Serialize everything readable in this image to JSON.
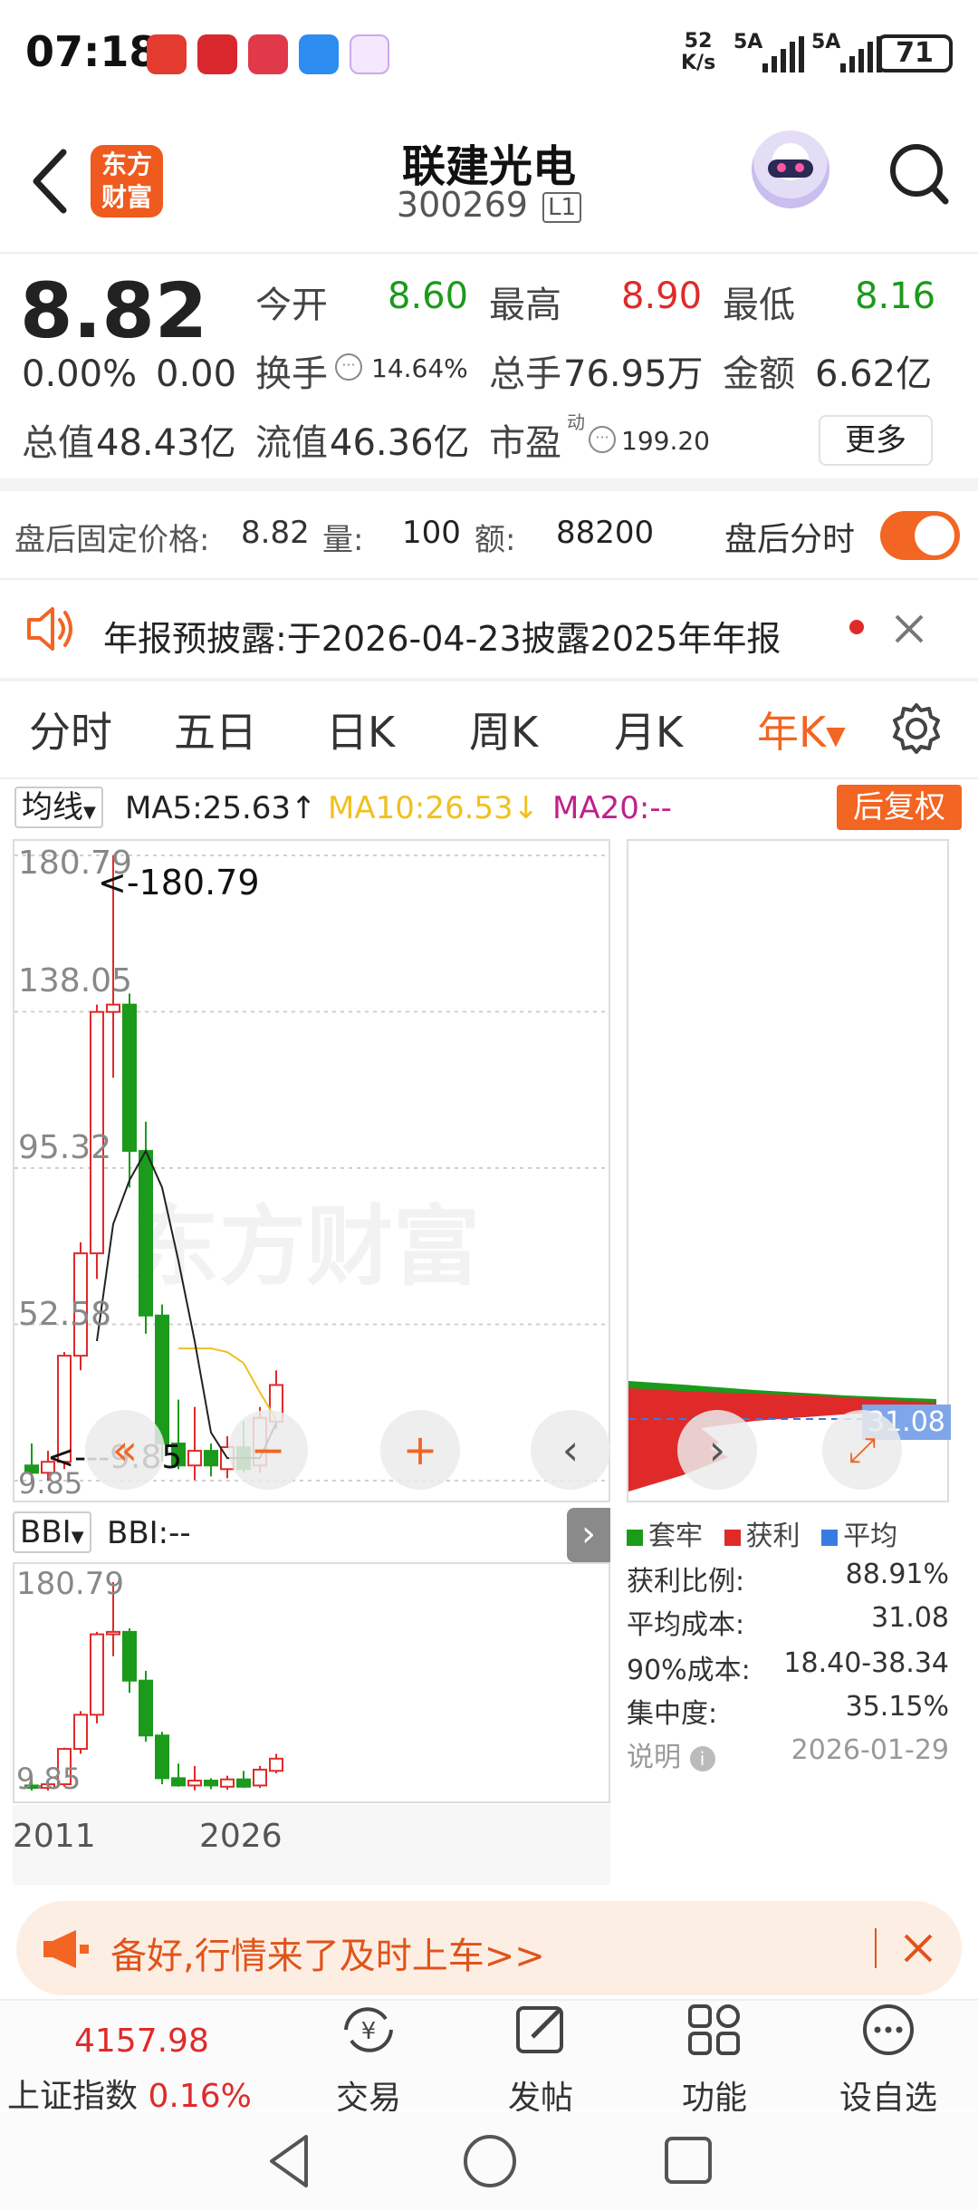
{
  "status_bar": {
    "time": "07:18",
    "net_speed_value": "52",
    "net_speed_unit": "K/s",
    "signal1": "5A",
    "signal2": "5A",
    "battery": "71"
  },
  "header": {
    "logo_text": "东方财富",
    "stock_name": "联建光电",
    "stock_code": "300269",
    "level_badge": "L1"
  },
  "quote": {
    "price": "8.82",
    "change_pct": "0.00%",
    "change_abs": "0.00",
    "open_label": "今开",
    "open_value": "8.60",
    "high_label": "最高",
    "high_value": "8.90",
    "low_label": "最低",
    "low_value": "8.16",
    "turnover_label": "换手",
    "turnover_value": "14.64%",
    "volume_label": "总手",
    "volume_value": "76.95万",
    "amount_label": "金额",
    "amount_value": "6.62亿",
    "mktcap_label": "总值",
    "mktcap_value": "48.43亿",
    "float_label": "流值",
    "float_value": "46.36亿",
    "pe_label": "市盈",
    "pe_sup": "动",
    "pe_value": "199.20",
    "more_button": "更多"
  },
  "after_hours": {
    "label": "盘后固定价格:",
    "price": "8.82",
    "vol_label": "量:",
    "vol_value": "100",
    "amt_label": "额:",
    "amt_value": "88200",
    "toggle_label": "盘后分时",
    "toggle_on": true
  },
  "notice": {
    "text": "年报预披露:于2026-04-23披露2025年年报"
  },
  "tabs": [
    "分时",
    "五日",
    "日K",
    "周K",
    "月K",
    "年K"
  ],
  "active_tab": 5,
  "ma_bar": {
    "selector": "均线",
    "ma5": "MA5:25.63↑",
    "ma10": "MA10:26.53↓",
    "ma20": "MA20:--",
    "adjust_button": "后复权"
  },
  "chart_labels": {
    "max_annot": "<-180.79",
    "min_annot": "<---9.85",
    "watermark": "东方财富",
    "y_ticks": [
      "180.79",
      "138.05",
      "95.32",
      "52.58",
      "9.85"
    ]
  },
  "bbi_bar": {
    "selector": "BBI",
    "value": "BBI:--"
  },
  "sub_chart": {
    "y_ticks": [
      "180.79",
      "9.85"
    ],
    "x_ticks": [
      "2011",
      "2026"
    ]
  },
  "chip_distribution": {
    "price_label": "31.08",
    "legend": [
      "套牢",
      "获利",
      "平均"
    ],
    "rows": [
      {
        "label": "获利比例:",
        "value": "88.91%"
      },
      {
        "label": "平均成本:",
        "value": "31.08"
      },
      {
        "label": "90%成本:",
        "value": "18.40-38.34"
      },
      {
        "label": "集中度:",
        "value": "35.15%"
      }
    ],
    "note_label": "说明",
    "note_date": "2026-01-29"
  },
  "promo": {
    "text": "备好,行情来了及时上车>>"
  },
  "bottom_nav": {
    "index_value": "4157.98",
    "index_name": "上证指数",
    "index_change": "0.16%",
    "items": [
      "交易",
      "发帖",
      "功能",
      "设自选"
    ]
  },
  "colors": {
    "up": "#e02a2a",
    "down": "#1b9a1b",
    "accent": "#f26522",
    "ma5": "#222222",
    "ma10": "#f0c020",
    "ma20": "#c0208a",
    "avg": "#3a7be0"
  },
  "chart_data": {
    "type": "candlestick",
    "period": "yearly",
    "series": [
      {
        "name": "年K",
        "candles": [
          {
            "o": 14.0,
            "h": 20.0,
            "l": 9.85,
            "c": 12.0
          },
          {
            "o": 12.0,
            "h": 18.0,
            "l": 9.85,
            "c": 15.0
          },
          {
            "o": 15.0,
            "h": 45.0,
            "l": 13.0,
            "c": 44.0
          },
          {
            "o": 44.0,
            "h": 75.0,
            "l": 40.0,
            "c": 72.0
          },
          {
            "o": 72.0,
            "h": 140.0,
            "l": 65.0,
            "c": 138.0
          },
          {
            "o": 138.0,
            "h": 180.79,
            "l": 120.0,
            "c": 140.0
          },
          {
            "o": 140.0,
            "h": 143.0,
            "l": 90.0,
            "c": 100.0
          },
          {
            "o": 100.0,
            "h": 108.0,
            "l": 50.0,
            "c": 55.0
          },
          {
            "o": 55.0,
            "h": 58.0,
            "l": 15.0,
            "c": 20.0
          },
          {
            "o": 20.0,
            "h": 32.0,
            "l": 13.0,
            "c": 14.0
          },
          {
            "o": 14.0,
            "h": 30.0,
            "l": 10.0,
            "c": 18.0
          },
          {
            "o": 18.0,
            "h": 20.0,
            "l": 11.0,
            "c": 14.0
          },
          {
            "o": 13.0,
            "h": 22.0,
            "l": 10.5,
            "c": 19.0
          },
          {
            "o": 19.0,
            "h": 26.0,
            "l": 12.0,
            "c": 13.0
          },
          {
            "o": 14.0,
            "h": 30.0,
            "l": 12.0,
            "c": 27.0
          },
          {
            "o": 26.0,
            "h": 40.0,
            "l": 24.0,
            "c": 36.0
          }
        ]
      },
      {
        "name": "MA5",
        "values": [
          null,
          null,
          null,
          null,
          48.0,
          80.0,
          92.0,
          100.0,
          90.0,
          70.0,
          48.0,
          23.0,
          16.0,
          16.0,
          16.0,
          25.63
        ]
      },
      {
        "name": "MA10",
        "values": [
          null,
          null,
          null,
          null,
          null,
          null,
          null,
          null,
          null,
          46.0,
          46.0,
          46.0,
          45.0,
          42.0,
          34.0,
          26.53
        ]
      }
    ],
    "ylim": [
      9.85,
      180.79
    ],
    "y_ticks": [
      180.79,
      138.05,
      95.32,
      52.58,
      9.85
    ]
  }
}
